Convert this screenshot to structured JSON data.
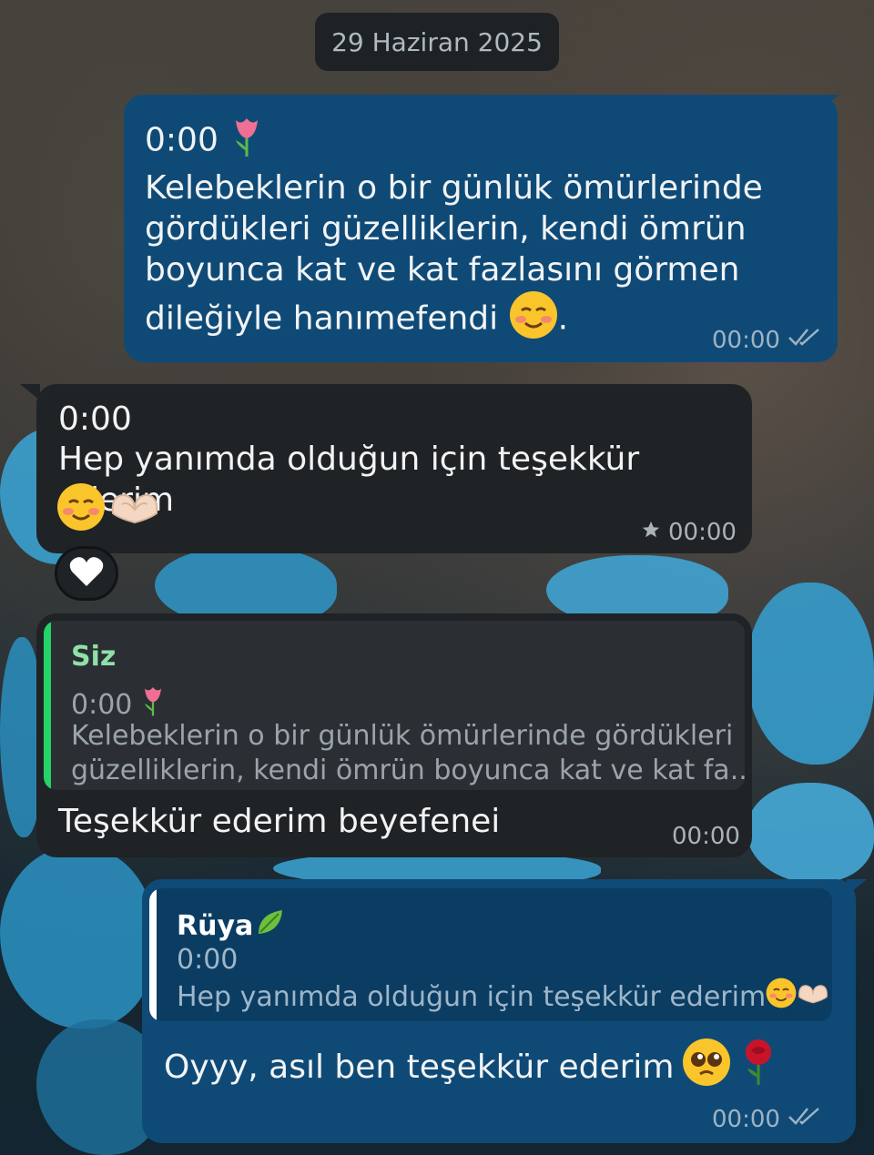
{
  "date_chip": "29 Haziran 2025",
  "messages": [
    {
      "direction": "outgoing",
      "time_line": "0:00",
      "text": "Kelebeklerin o bir günlük ömürlerinde gördükleri güzelliklerin, kendi ömrün boyunca kat ve kat fazlasını görmen dileğiyle hanımefendi",
      "text_end": ".",
      "timestamp": "00:00",
      "status_icon": "double-check-icon",
      "emojis": [
        "tulip",
        "smiling-face"
      ]
    },
    {
      "direction": "incoming",
      "time_line": "0:00",
      "text": "Hep yanımda olduğun için teşekkür ederim",
      "timestamp": "00:00",
      "starred_icon": "star-icon",
      "emojis": [
        "smiling-face",
        "heart-hands"
      ],
      "reaction": "white-heart"
    },
    {
      "direction": "incoming",
      "quote": {
        "sender": "Siz",
        "time_line": "0:00",
        "text_line1": "Kelebeklerin o bir günlük ömürlerinde gördükleri",
        "text_line2": "güzelliklerin, kendi ömrün boyunca kat ve kat fa...",
        "accent": "#25d366",
        "emojis": [
          "tulip"
        ]
      },
      "text": "Teşekkür ederim beyefenei",
      "timestamp": "00:00"
    },
    {
      "direction": "outgoing",
      "quote": {
        "sender": "Rüya",
        "time_line": "0:00",
        "text": "Hep yanımda olduğun için teşekkür ederim",
        "accent": "#ffffff",
        "emojis": [
          "leaf",
          "smiling-face",
          "heart-hands"
        ]
      },
      "text": "Oyyy, asıl ben teşekkür ederim",
      "timestamp": "00:00",
      "status_icon": "double-check-icon",
      "emojis": [
        "pleading-face",
        "rose"
      ]
    }
  ],
  "colors": {
    "outgoing_bubble": "#0f4a77",
    "incoming_bubble": "#1f2326",
    "quote_in_bg": "#2b2f33",
    "quote_out_bg": "#0b3d63"
  }
}
